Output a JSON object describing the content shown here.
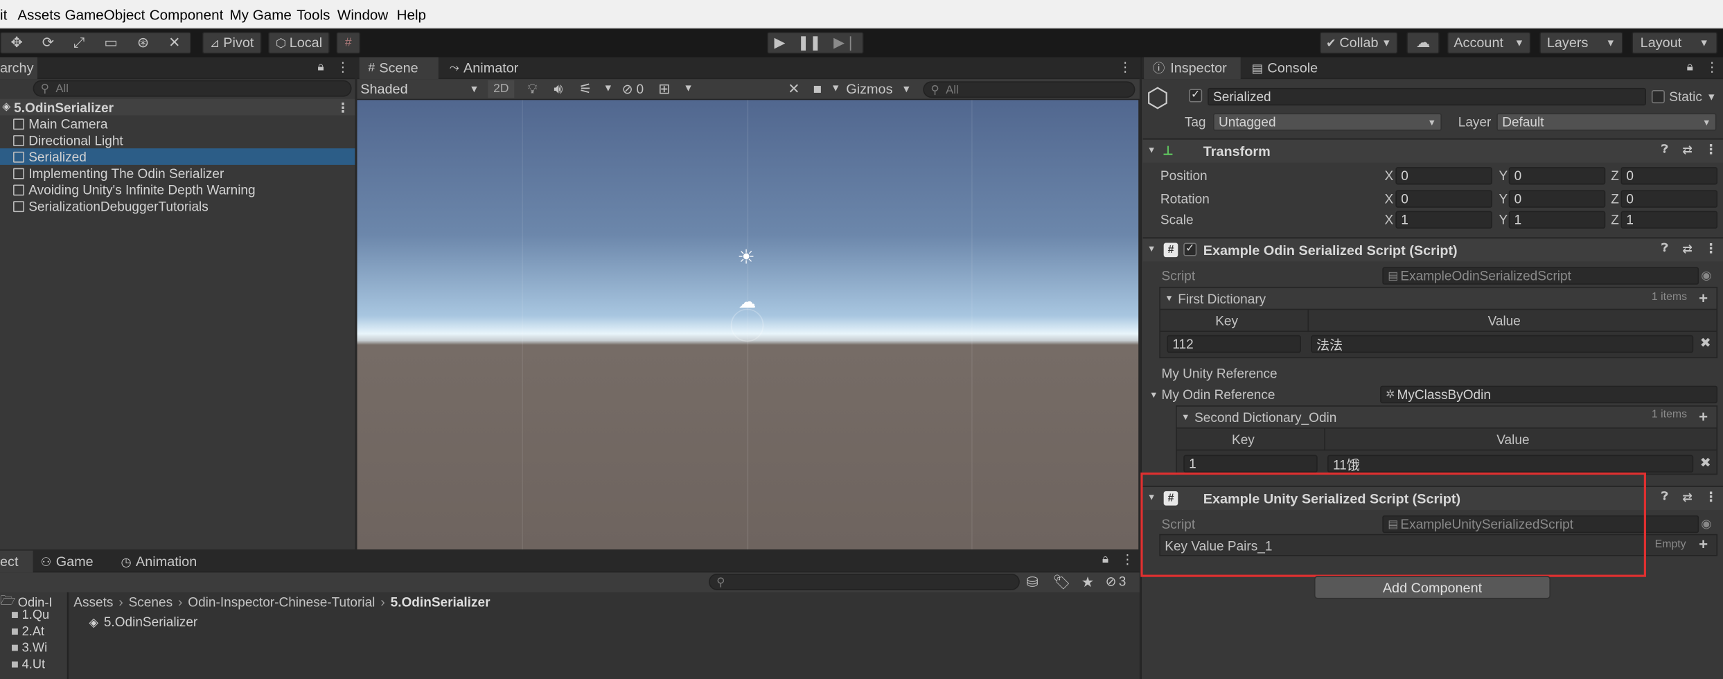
{
  "menu": [
    "it",
    "Assets",
    "GameObject",
    "Component",
    "My Game",
    "Tools",
    "Window",
    "Help"
  ],
  "toolbar": {
    "pivot": "Pivot",
    "local": "Local",
    "collab": "Collab",
    "account": "Account",
    "layers": "Layers",
    "layout": "Layout"
  },
  "hierarchy": {
    "tab_label": "archy",
    "search_placeholder": "All",
    "scene_name": "5.OdinSerializer",
    "items": [
      {
        "label": "Main Camera",
        "selected": false
      },
      {
        "label": "Directional Light",
        "selected": false
      },
      {
        "label": "Serialized",
        "selected": true
      },
      {
        "label": "Implementing The Odin Serializer",
        "selected": false
      },
      {
        "label": "Avoiding Unity's Infinite Depth Warning",
        "selected": false
      },
      {
        "label": "SerializationDebuggerTutorials",
        "selected": false
      }
    ]
  },
  "scene": {
    "tabs": [
      "Scene",
      "Animator"
    ],
    "shading": "Shaded",
    "mode_2d": "2D",
    "hidden_count": "0",
    "gizmos": "Gizmos",
    "search_placeholder": "All"
  },
  "bottom": {
    "tabs": [
      "ect",
      "Game",
      "Animation"
    ],
    "hidden_count": "3",
    "breadcrumb": [
      "Assets",
      "Scenes",
      "Odin-Inspector-Chinese-Tutorial",
      "5.OdinSerializer"
    ],
    "folders": [
      "Odin-I",
      "1.Qu",
      "2.At",
      "3.Wi",
      "4.Ut"
    ],
    "asset": "5.OdinSerializer"
  },
  "inspector": {
    "tabs": [
      "Inspector",
      "Console"
    ],
    "object_name": "Serialized",
    "static_label": "Static",
    "tag_label": "Tag",
    "tag_value": "Untagged",
    "layer_label": "Layer",
    "layer_value": "Default",
    "transform": {
      "title": "Transform",
      "rows": [
        {
          "label": "Position",
          "x": "0",
          "y": "0",
          "z": "0"
        },
        {
          "label": "Rotation",
          "x": "0",
          "y": "0",
          "z": "0"
        },
        {
          "label": "Scale",
          "x": "1",
          "y": "1",
          "z": "1"
        }
      ]
    },
    "odin_script": {
      "title": "Example Odin Serialized Script (Script)",
      "script_label": "Script",
      "script_value": "ExampleOdinSerializedScript",
      "first_dict_label": "First Dictionary",
      "first_dict_count": "1 items",
      "key_header": "Key",
      "value_header": "Value",
      "first_key": "112",
      "first_value": "法法",
      "my_unity_ref": "My Unity Reference",
      "my_odin_ref": "My Odin Reference",
      "my_odin_ref_value": "MyClassByOdin",
      "second_dict_label": "Second Dictionary_Odin",
      "second_dict_count": "1 items",
      "second_key": "1",
      "second_value": "11饿"
    },
    "unity_script": {
      "title": "Example Unity Serialized Script (Script)",
      "script_label": "Script",
      "script_value": "ExampleUnitySerializedScript",
      "kvp_label": "Key Value Pairs_1",
      "kvp_state": "Empty"
    },
    "add_component": "Add Component"
  },
  "colors": {
    "selection": "#2c5d87",
    "highlight_box": "#e03030"
  }
}
